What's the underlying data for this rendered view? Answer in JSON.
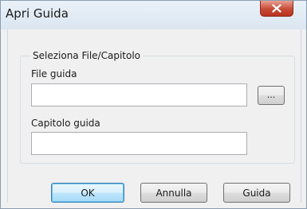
{
  "window": {
    "title": "Apri Guida"
  },
  "group": {
    "title": "Seleziona File/Capitolo",
    "file_label": "File guida",
    "file_value": "",
    "browse_label": "...",
    "chapter_label": "Capitolo guida",
    "chapter_value": ""
  },
  "buttons": {
    "ok": "OK",
    "cancel": "Annulla",
    "help": "Guida"
  }
}
